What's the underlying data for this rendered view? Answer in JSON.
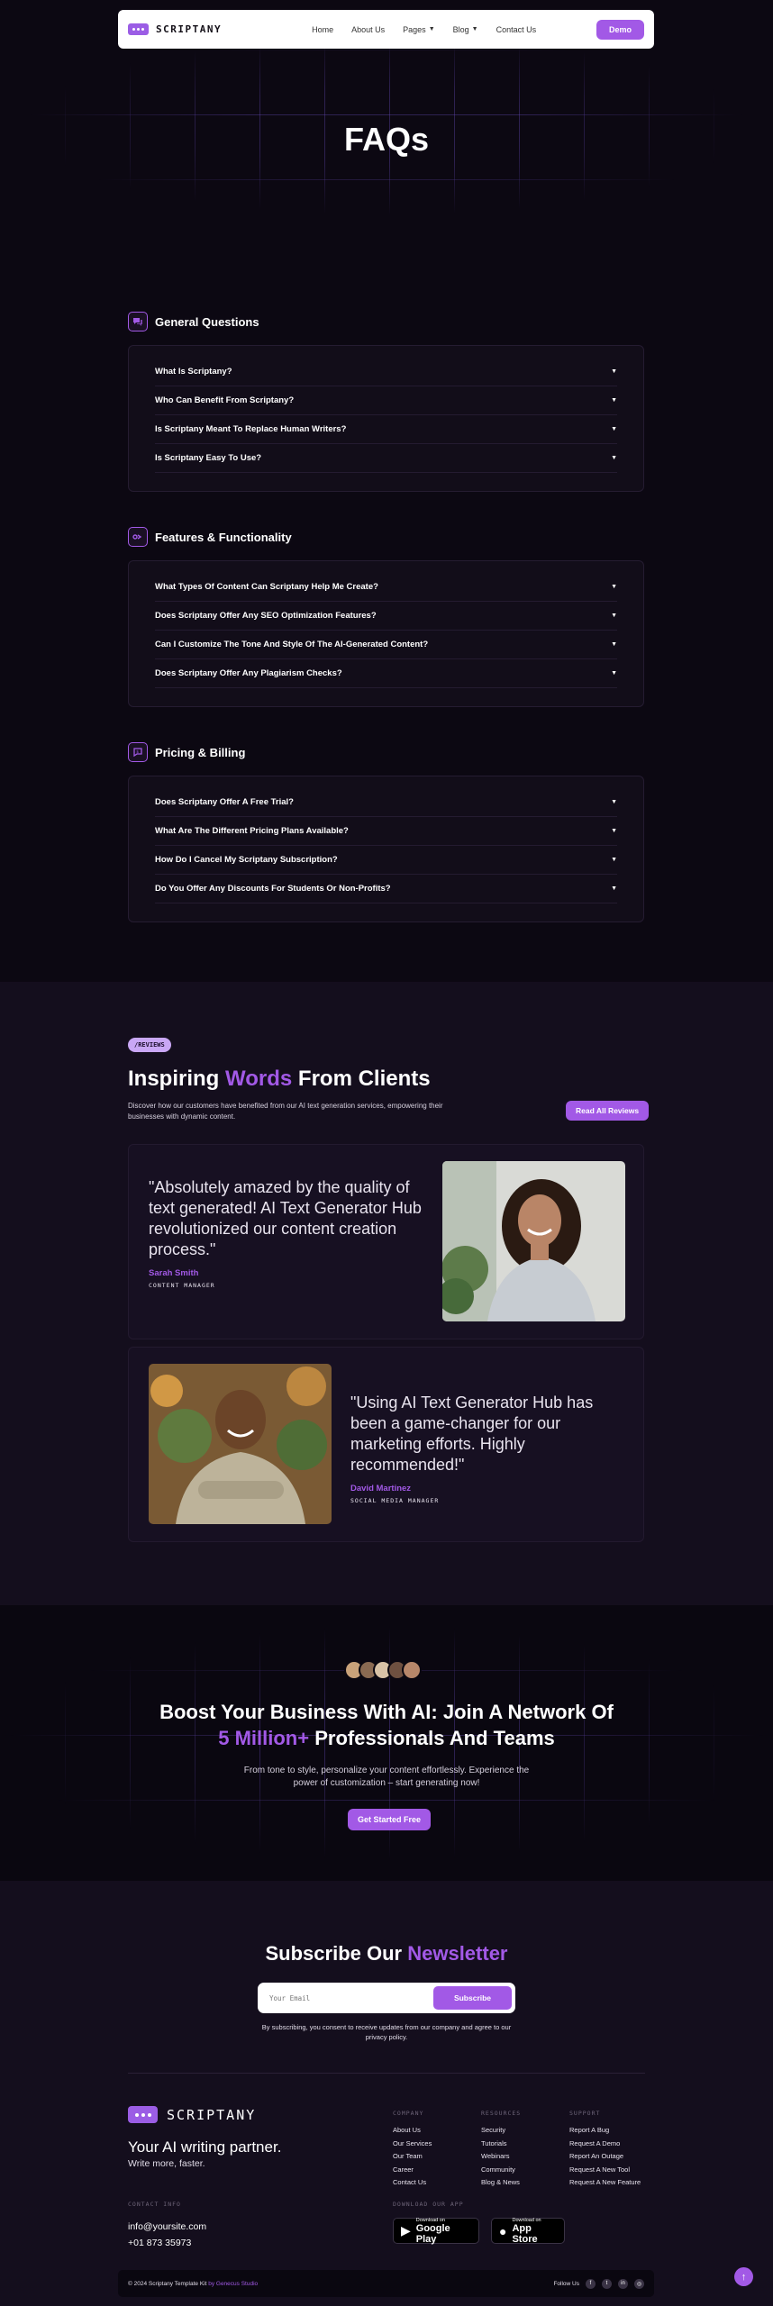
{
  "nav": {
    "logo": "SCRIPTANY",
    "links": [
      {
        "label": "Home",
        "dropdown": false
      },
      {
        "label": "About Us",
        "dropdown": false
      },
      {
        "label": "Pages",
        "dropdown": true
      },
      {
        "label": "Blog",
        "dropdown": true
      },
      {
        "label": "Contact Us",
        "dropdown": false
      }
    ],
    "demo_label": "Demo"
  },
  "hero": {
    "title": "FAQs"
  },
  "faq": [
    {
      "title": "General Questions",
      "icon": "chat-bubbles-icon",
      "items": [
        "What Is Scriptany?",
        "Who Can Benefit From Scriptany?",
        "Is Scriptany Meant To Replace Human Writers?",
        "Is Scriptany Easy To Use?"
      ]
    },
    {
      "title": "Features & Functionality",
      "icon": "sliders-icon",
      "items": [
        "What Types Of Content Can Scriptany Help Me Create?",
        "Does Scriptany Offer Any SEO Optimization Features?",
        "Can I Customize The Tone And Style Of The AI-Generated Content?",
        "Does Scriptany Offer Any Plagiarism Checks?"
      ]
    },
    {
      "title": "Pricing & Billing",
      "icon": "dollar-bubble-icon",
      "items": [
        "Does Scriptany Offer A Free Trial?",
        "What Are The Different Pricing Plans Available?",
        "How Do I Cancel My Scriptany Subscription?",
        "Do You Offer Any Discounts For Students Or Non-Profits?"
      ]
    }
  ],
  "reviews": {
    "pill": "/REVIEWS",
    "title_pre": "Inspiring ",
    "title_accent": "Words",
    "title_post": " From Clients",
    "description": "Discover how our customers have benefited from our AI text generation services, empowering their businesses with dynamic content.",
    "button": "Read All Reviews",
    "items": [
      {
        "quote": "\"Absolutely amazed by the quality of text generated! AI Text Generator Hub revolutionized our content creation process.\"",
        "name": "Sarah Smith",
        "role": "CONTENT MANAGER"
      },
      {
        "quote": "\"Using AI Text Generator Hub has been a game-changer for our marketing efforts. Highly recommended!\"",
        "name": "David Martinez",
        "role": "SOCIAL MEDIA MANAGER"
      }
    ]
  },
  "cta": {
    "title_line1": "Boost Your Business With AI: Join A Network Of",
    "title_accent": "5 Million+",
    "title_line2_post": " Professionals And Teams",
    "description": "From tone to style, personalize your content effortlessly. Experience the power of customization – start generating now!",
    "button": "Get Started Free"
  },
  "newsletter": {
    "title_pre": "Subscribe Our ",
    "title_accent": "Newsletter",
    "placeholder": "Your Email",
    "button": "Subscribe",
    "note": "By subscribing, you consent to receive updates from our company and agree to our privacy policy."
  },
  "footer": {
    "logo": "SCRIPTANY",
    "tagline": "Your AI writing partner.",
    "tagline_sub": "Write more, faster.",
    "contact_head": "CONTACT INFO",
    "email": "info@yoursite.com",
    "phone": "+01 873 35973",
    "columns": [
      {
        "head": "COMPANY",
        "items": [
          "About Us",
          "Our Services",
          "Our Team",
          "Career",
          "Contact Us"
        ]
      },
      {
        "head": "RESOURCES",
        "items": [
          "Security",
          "Tutorials",
          "Webinars",
          "Community",
          "Blog & News"
        ]
      },
      {
        "head": "SUPPORT",
        "items": [
          "Report A Bug",
          "Request A Demo",
          "Report An Outage",
          "Request A New Tool",
          "Request A New Feature"
        ]
      }
    ],
    "download_head": "DOWNLOAD OUR APP",
    "google": {
      "small": "Download on",
      "big": "Google Play"
    },
    "apple": {
      "small": "Download on",
      "big": "App Store"
    },
    "copyright": "© 2024 Scriptany Template Kit ",
    "copyright_link": "by Genecus Studio",
    "follow": "Follow Us"
  },
  "colors": {
    "accent": "#a259e6",
    "background": "#0c0812",
    "section": "#140e1d"
  }
}
